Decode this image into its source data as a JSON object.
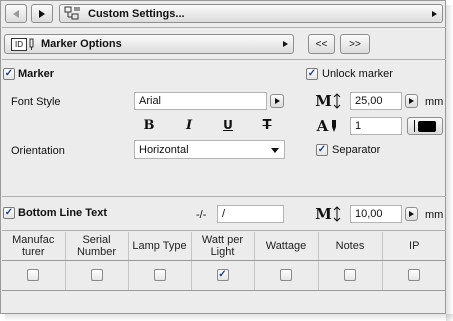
{
  "toolbar": {
    "title": "Custom Settings...",
    "back_icon": "triangle-left-icon",
    "forward_icon": "triangle-right-icon",
    "settings_icon": "custom-settings-icon"
  },
  "marker_options": {
    "label": "Marker Options",
    "badge": "ID",
    "prev_label": "<<",
    "next_label": ">>"
  },
  "marker": {
    "checkbox_label": "Marker",
    "checked": true,
    "unlock_label": "Unlock marker",
    "unlock_checked": true,
    "font_style_label": "Font Style",
    "font_value": "Arial",
    "bold_label": "B",
    "italic_label": "I",
    "underline_label": "U",
    "strike_label": "T",
    "size_value": "25,00",
    "size_unit": "mm",
    "pen_value": "1",
    "orientation_label": "Orientation",
    "orientation_value": "Horizontal",
    "separator_label": "Separator",
    "separator_checked": true
  },
  "bottom_line": {
    "checkbox_label": "Bottom Line Text",
    "checked": true,
    "prefix_label": "-/-",
    "text_value": "/",
    "size_value": "10,00",
    "size_unit": "mm"
  },
  "table": {
    "columns": [
      {
        "line1": "Manufac",
        "line2": "turer"
      },
      {
        "line1": "Serial",
        "line2": "Number"
      },
      {
        "line1": "Lamp Type",
        "line2": ""
      },
      {
        "line1": "Watt per",
        "line2": "Light"
      },
      {
        "line1": "Wattage",
        "line2": ""
      },
      {
        "line1": "Notes",
        "line2": ""
      },
      {
        "line1": "IP",
        "line2": ""
      }
    ],
    "checked": [
      false,
      false,
      false,
      true,
      false,
      false,
      false
    ]
  },
  "colors": {
    "panel_bg": "#ececec",
    "check_color": "#1f3f8a",
    "pen_swatch": "#000000"
  }
}
